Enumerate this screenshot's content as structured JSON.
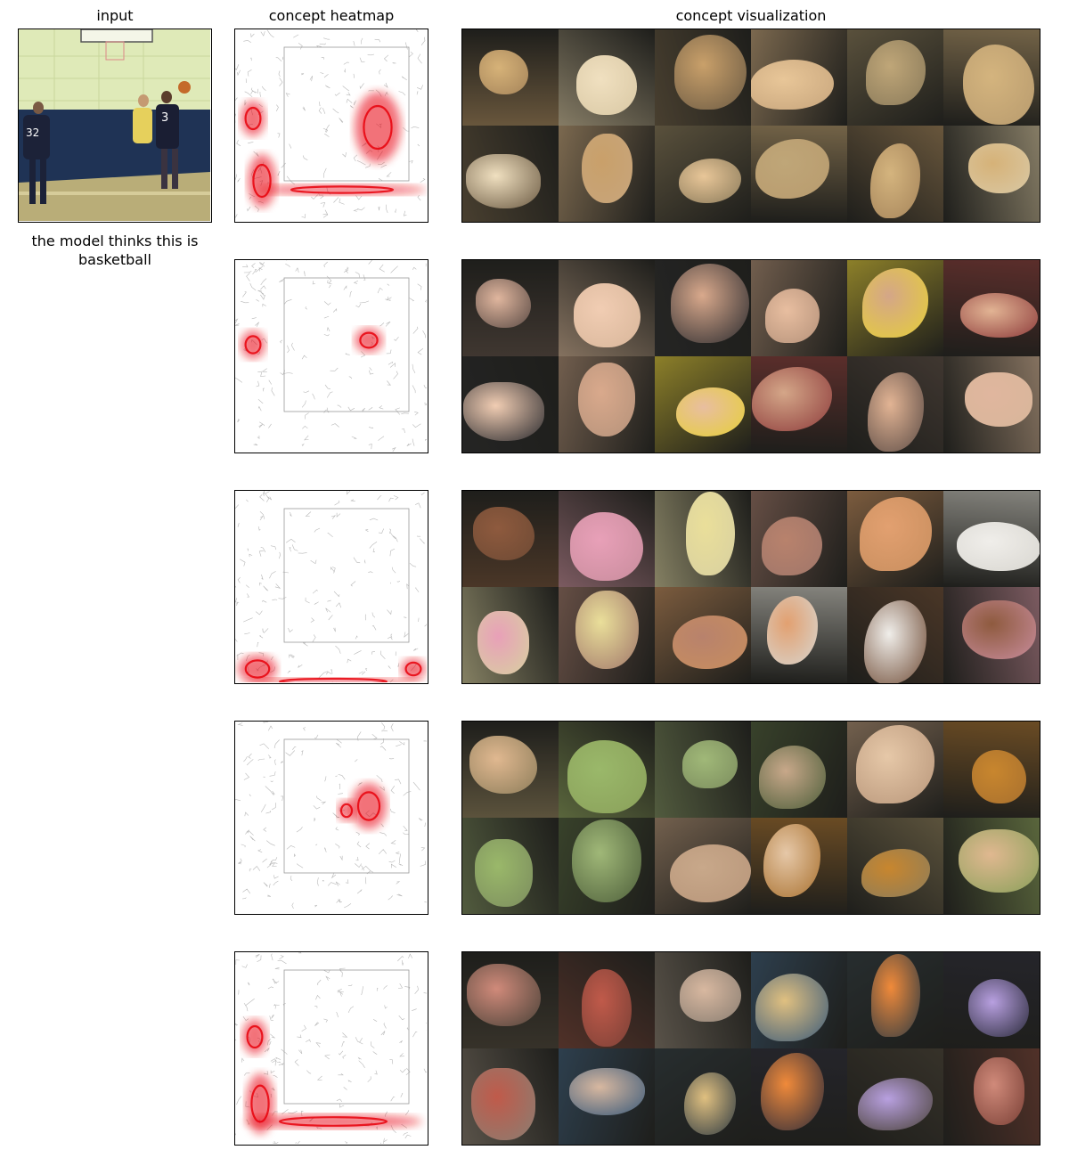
{
  "titles": {
    "input": "input",
    "heatmap": "concept heatmap",
    "visualization": "concept visualization"
  },
  "prediction": "the model thinks this is basketball",
  "concept_rows": [
    {
      "heatmap_focus": "left player and court floor"
    },
    {
      "heatmap_focus": "player heads"
    },
    {
      "heatmap_focus": "floor bottom-left"
    },
    {
      "heatmap_focus": "jumping player"
    },
    {
      "heatmap_focus": "left player and floor"
    }
  ],
  "colors": {
    "heat": "#e8000b",
    "frame": "#000000",
    "input_wall": "#d9e8b0",
    "input_mat": "#1f3355",
    "input_floor": "#b9ad78"
  }
}
